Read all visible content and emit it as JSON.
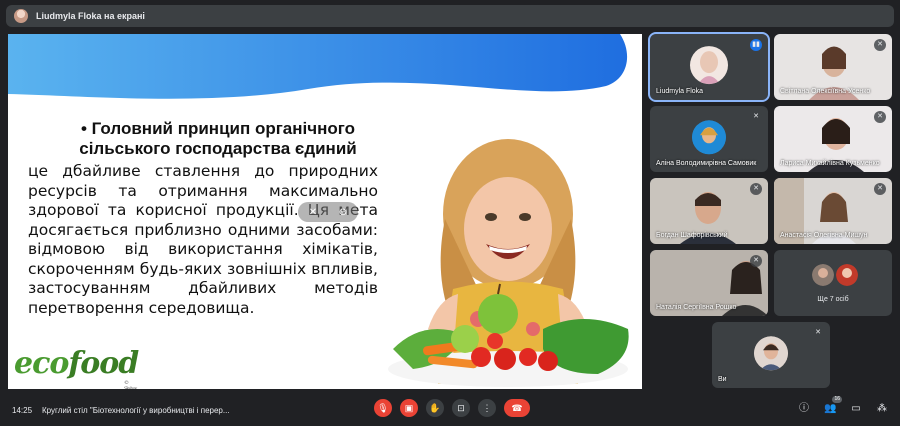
{
  "topbar": {
    "presenter_title": "Liudmyla Floka на екрані"
  },
  "slide": {
    "heading": "• Головний принцип органічного сільського господарства єдиний",
    "body": "це дбайливе ставлення до природних ресурсів та отримання максимально здорової та корисної продукції. Ця мета досягається приблизно одними засобами: відмовою від використання хімікатів, скороченням будь-яких зовнішніх впливів, застосуванням дбайливих методів перетворення середовища.",
    "logo_eco": "eco",
    "logo_food": "food",
    "logo_sub": "© Skybox"
  },
  "participants": [
    {
      "name": "Liudmyla Floka",
      "mic": "on"
    },
    {
      "name": "Світлана Олексіївна Усенко",
      "mic": "off"
    },
    {
      "name": "Аліна Володимирівна Самовик",
      "mic": "off"
    },
    {
      "name": "Лариса Михайлівна Кузьменко",
      "mic": "off"
    },
    {
      "name": "Богдан Шафорівський",
      "mic": "off"
    },
    {
      "name": "Анастасія Олегівна Мишун",
      "mic": "off"
    },
    {
      "name": "Наталія Сергіївна Рошко",
      "mic": "off"
    },
    {
      "name": "Ще 7 осіб",
      "mic": "off"
    },
    {
      "name": "Ви",
      "mic": "off"
    }
  ],
  "bottombar": {
    "time": "14:25",
    "meeting_title": "Круглий стіл \"Біотехнології у виробництві і перер...",
    "participants_count": "16"
  },
  "colors": {
    "accent": "#1a73e8",
    "danger": "#ea4335",
    "panel": "#3c4043",
    "bg": "#202124"
  }
}
